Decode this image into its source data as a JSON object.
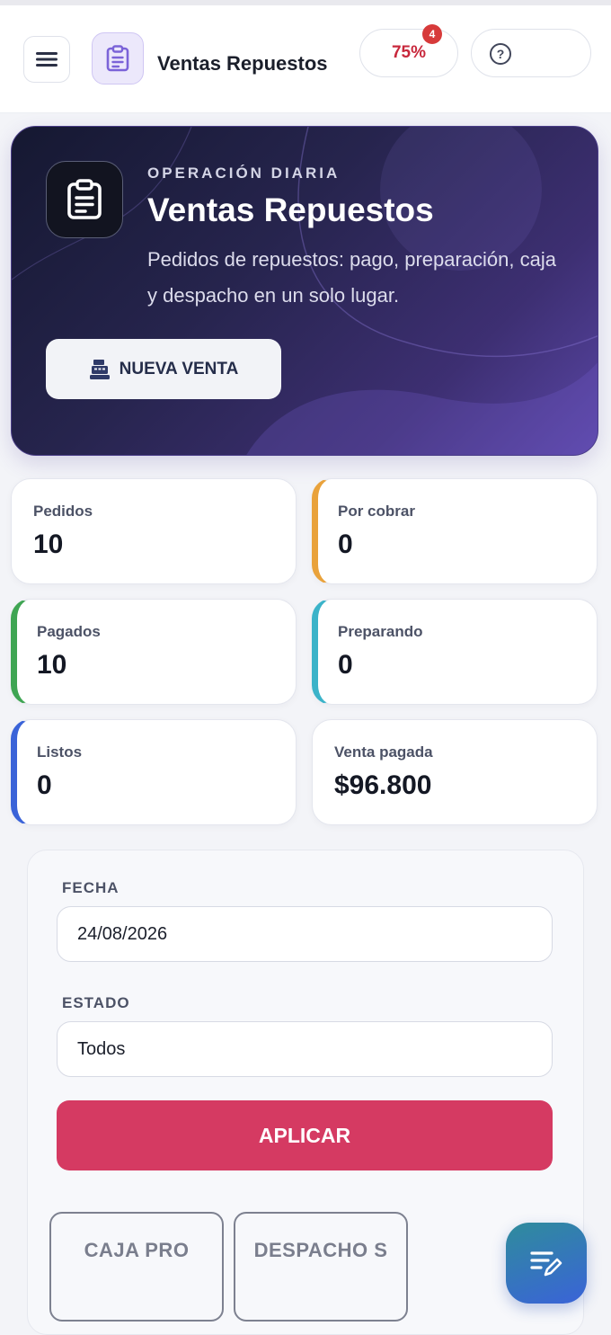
{
  "header": {
    "menu_icon": "hamburger-menu-icon",
    "app_icon": "clipboard-icon",
    "title": "Ventas Repuestos",
    "progress_label": "75%",
    "progress_value": 0.75,
    "notification_count": "4",
    "help_icon": "question-circle-icon"
  },
  "hero": {
    "icon": "clipboard-icon",
    "eyebrow": "OPERACIÓN DIARIA",
    "title": "Ventas Repuestos",
    "description": "Pedidos de repuestos: pago, preparación, caja y despacho en un solo lugar.",
    "new_sale_icon": "cash-register-icon",
    "new_sale_label": "NUEVA VENTA"
  },
  "stats": [
    {
      "label": "Pedidos",
      "value": "10",
      "accent": ""
    },
    {
      "label": "Por cobrar",
      "value": "0",
      "accent": "#e9a23b"
    },
    {
      "label": "Pagados",
      "value": "10",
      "accent": "#3fa553"
    },
    {
      "label": "Preparando",
      "value": "0",
      "accent": "#3bb3c9"
    },
    {
      "label": "Listos",
      "value": "0",
      "accent": "#3a63d8"
    },
    {
      "label": "Venta pagada",
      "value": "$96.800",
      "accent": ""
    }
  ],
  "filters": {
    "date_label": "FECHA",
    "date_value": "24/08/2026",
    "status_label": "ESTADO",
    "status_value": "Todos",
    "apply_label": "APLICAR"
  },
  "tabs": [
    {
      "label": "CAJA PRO"
    },
    {
      "label": "DESPACHO S"
    }
  ],
  "fab": {
    "icon": "list-edit-icon"
  },
  "colors": {
    "brand": "#5a46a6",
    "danger": "#d53a62",
    "badge": "#d73a3a"
  }
}
